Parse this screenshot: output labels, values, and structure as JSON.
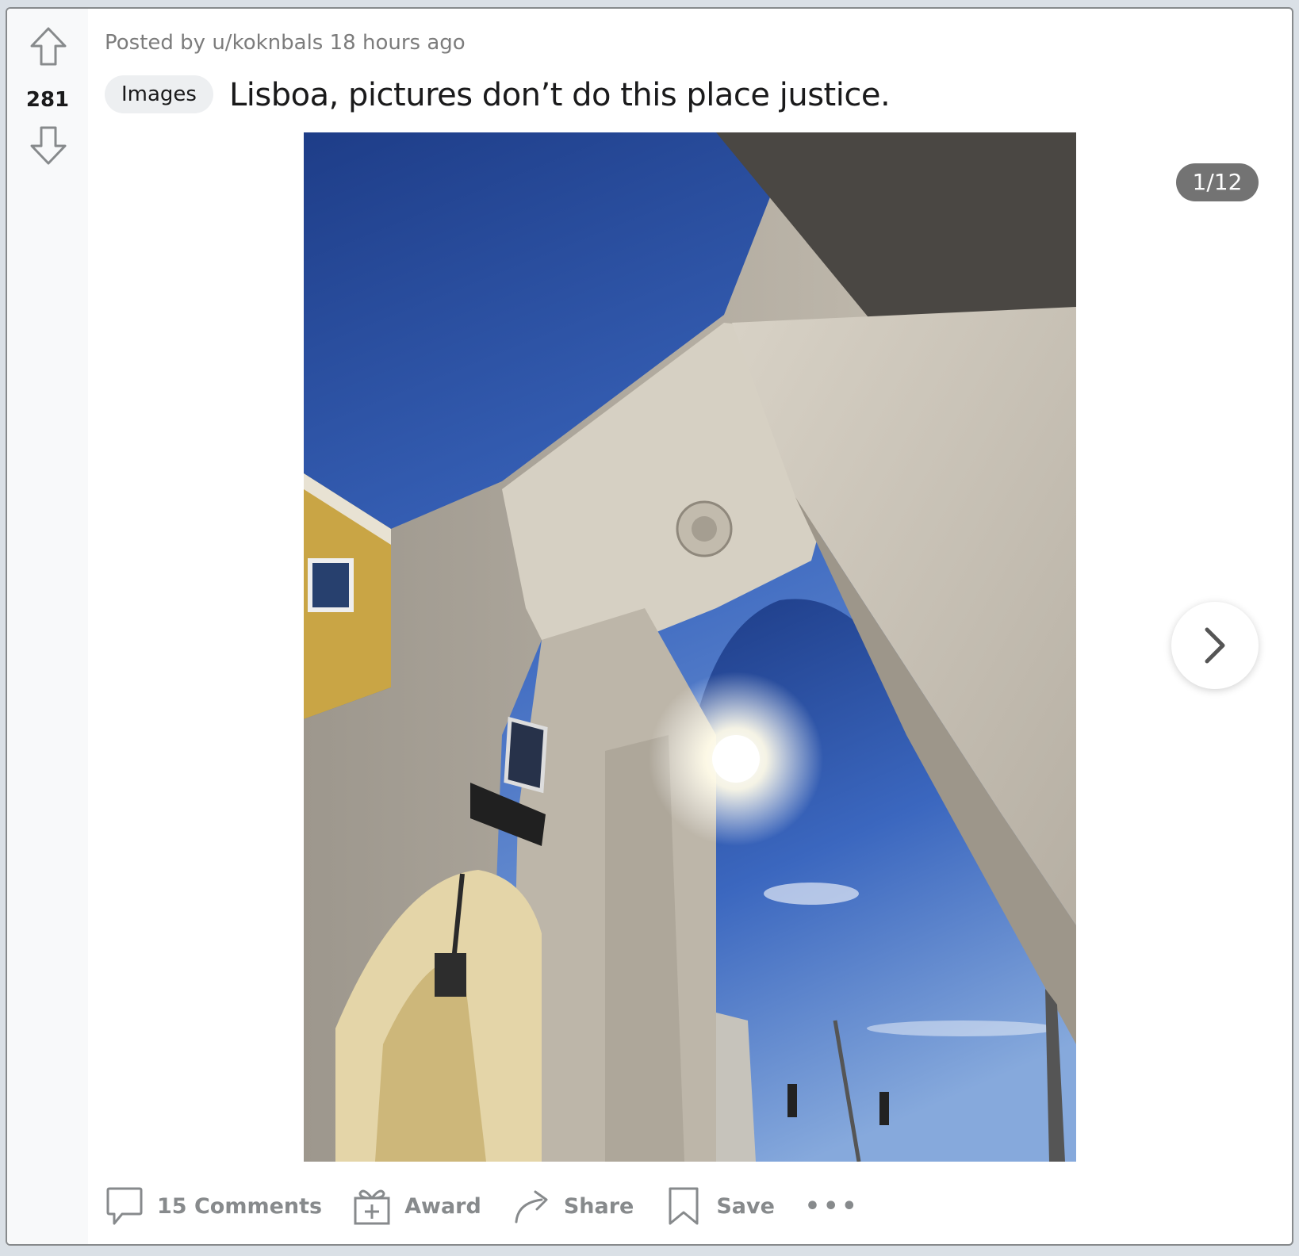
{
  "post": {
    "score": "281",
    "meta": {
      "prefix": "Posted by",
      "user": "u/koknbals",
      "time": "18 hours ago"
    },
    "flair": "Images",
    "title": "Lisboa, pictures don’t do this place justice.",
    "gallery_counter": "1/12"
  },
  "actions": {
    "comments": "15 Comments",
    "award": "Award",
    "share": "Share",
    "save": "Save",
    "more": "•••"
  },
  "colors": {
    "sky_top": "#1f3f8a",
    "sky_bottom": "#7fa3d9",
    "stone": "#cfc8bc",
    "accent_text": "#1a1a1b",
    "muted_text": "#878a8c"
  },
  "icons": {
    "upvote": "arrow-up-outline-icon",
    "downvote": "arrow-down-outline-icon",
    "next": "chevron-right-icon",
    "comments": "speech-bubble-icon",
    "award": "gift-icon",
    "share": "share-arrow-icon",
    "save": "bookmark-icon"
  }
}
